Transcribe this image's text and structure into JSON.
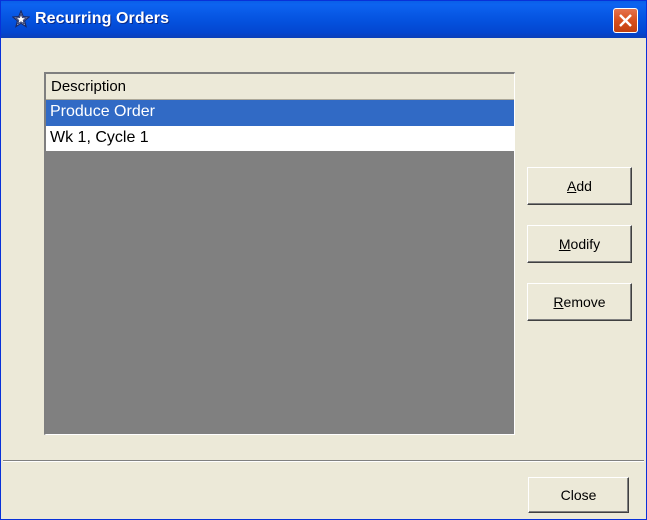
{
  "window": {
    "title": "Recurring Orders"
  },
  "list": {
    "header": "Description",
    "rows": [
      {
        "label": "Produce Order",
        "selected": true
      },
      {
        "label": "Wk 1, Cycle 1",
        "selected": false
      }
    ]
  },
  "buttons": {
    "add": {
      "mnemonic": "A",
      "rest": "dd"
    },
    "modify": {
      "mnemonic": "M",
      "rest": "odify"
    },
    "remove": {
      "mnemonic": "R",
      "rest": "emove"
    },
    "close": "Close"
  },
  "colors": {
    "titlebar": "#0553e0",
    "selection": "#316ac5",
    "dialog_bg": "#ece9d8",
    "list_bg": "#808080"
  },
  "icons": {
    "app": "star-icon",
    "close": "close-x-icon"
  }
}
